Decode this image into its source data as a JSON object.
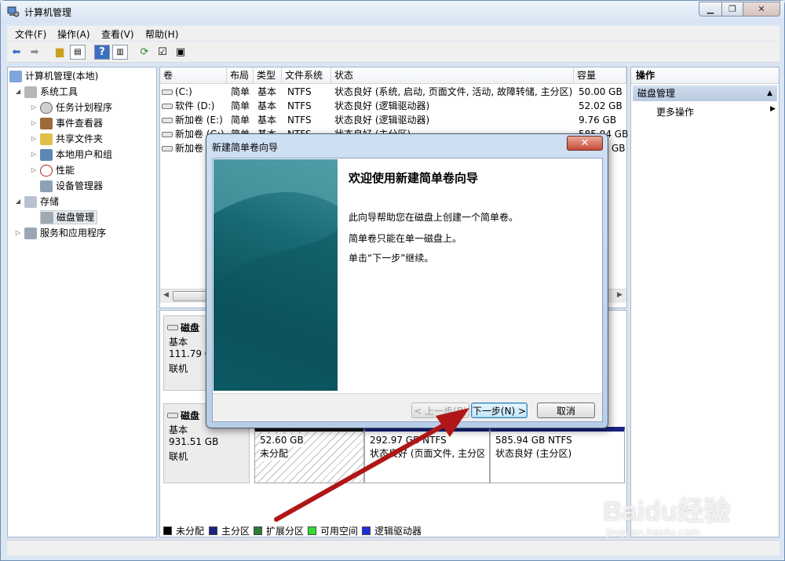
{
  "window": {
    "title": "计算机管理"
  },
  "menu": [
    "文件(F)",
    "操作(A)",
    "查看(V)",
    "帮助(H)"
  ],
  "tree": {
    "root": "计算机管理(本地)",
    "system_tools": "系统工具",
    "items": [
      "任务计划程序",
      "事件查看器",
      "共享文件夹",
      "本地用户和组",
      "性能",
      "设备管理器"
    ],
    "storage": "存储",
    "disk_mgmt": "磁盘管理",
    "services": "服务和应用程序"
  },
  "volumes": {
    "headers": [
      "卷",
      "布局",
      "类型",
      "文件系统",
      "状态",
      "容量"
    ],
    "rows": [
      [
        "(C:)",
        "简单",
        "基本",
        "NTFS",
        "状态良好 (系统, 启动, 页面文件, 活动, 故障转储, 主分区)",
        "50.00 GB"
      ],
      [
        "软件 (D:)",
        "简单",
        "基本",
        "NTFS",
        "状态良好 (逻辑驱动器)",
        "52.02 GB"
      ],
      [
        "新加卷 (E:)",
        "简单",
        "基本",
        "NTFS",
        "状态良好 (逻辑驱动器)",
        "9.76 GB"
      ],
      [
        "新加卷 (G:)",
        "简单",
        "基本",
        "NTFS",
        "状态良好 (主分区)",
        "585.94 GB"
      ],
      [
        "新加卷",
        "",
        "",
        "",
        "",
        "GB"
      ]
    ]
  },
  "disks": [
    {
      "name": "磁盘",
      "type": "基本",
      "size": "111.79 GB",
      "status": "联机"
    },
    {
      "name": "磁盘",
      "type": "基本",
      "size": "931.51 GB",
      "status": "联机"
    }
  ],
  "partitions": [
    {
      "size": "52.60 GB",
      "status": "未分配"
    },
    {
      "size": "292.97 GB NTFS",
      "status": "状态良好 (页面文件, 主分区"
    },
    {
      "size": "585.94 GB NTFS",
      "status": "状态良好 (主分区)"
    }
  ],
  "legend": [
    {
      "label": "未分配",
      "color": "#000000"
    },
    {
      "label": "主分区",
      "color": "#1a237e"
    },
    {
      "label": "扩展分区",
      "color": "#2e7d32"
    },
    {
      "label": "可用空间",
      "color": "#33dd33"
    },
    {
      "label": "逻辑驱动器",
      "color": "#1f2fd8"
    }
  ],
  "actions": {
    "header": "操作",
    "section": "磁盘管理",
    "more": "更多操作"
  },
  "dialog": {
    "title": "新建简单卷向导",
    "heading": "欢迎使用新建简单卷向导",
    "line1": "此向导帮助您在磁盘上创建一个简单卷。",
    "line2": "简单卷只能在单一磁盘上。",
    "line3": "单击“下一步”继续。",
    "back": "< 上一步(B)",
    "next": "下一步(N) >",
    "cancel": "取消",
    "close": "✕"
  },
  "watermark": {
    "brand": "Baidu经验",
    "url": "jingyan.baidu.com"
  }
}
